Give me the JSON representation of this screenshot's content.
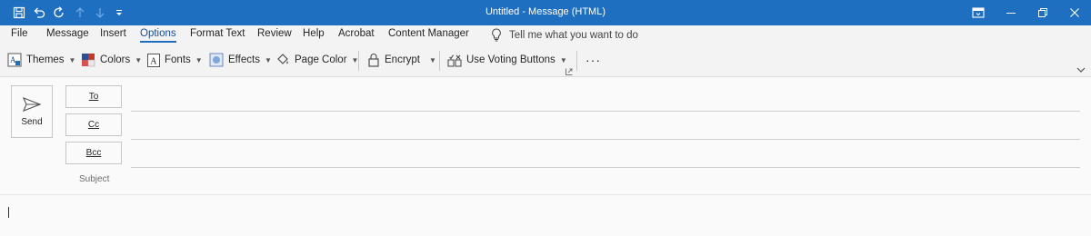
{
  "window": {
    "title": "Untitled  -  Message (HTML)"
  },
  "quick_access": {
    "icons": [
      "save-icon",
      "undo-icon",
      "redo-icon",
      "up-arrow-icon",
      "down-arrow-icon",
      "customize-qat-icon"
    ]
  },
  "window_controls": [
    "ribbon-display-options-icon",
    "minimize-icon",
    "restore-icon",
    "close-icon"
  ],
  "menu": {
    "tabs": [
      {
        "label": "File"
      },
      {
        "label": "Message"
      },
      {
        "label": "Insert"
      },
      {
        "label": "Options",
        "active": true
      },
      {
        "label": "Format Text"
      },
      {
        "label": "Review"
      },
      {
        "label": "Help"
      },
      {
        "label": "Acrobat"
      },
      {
        "label": "Content Manager"
      }
    ],
    "tell_me": "Tell me what you want to do"
  },
  "ribbon": {
    "themes": "Themes",
    "colors": "Colors",
    "fonts": "Fonts",
    "effects": "Effects",
    "page_color": "Page Color",
    "encrypt": "Encrypt",
    "voting": "Use Voting Buttons",
    "more": "···"
  },
  "compose": {
    "send": "Send",
    "to": "To",
    "cc": "Cc",
    "bcc": "Bcc",
    "subject": "Subject",
    "to_value": "",
    "cc_value": "",
    "bcc_value": "",
    "subject_value": "",
    "body": ""
  },
  "colors": {
    "titlebar": "#1e6fc0",
    "accent": "#1e6fc0",
    "background": "#f3f3f3"
  }
}
